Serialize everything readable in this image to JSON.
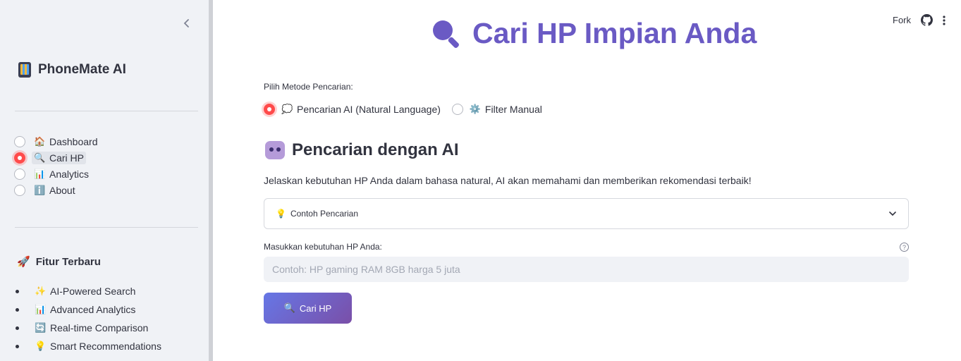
{
  "sidebar": {
    "brand_icon": "mobile-phone-icon",
    "brand": "PhoneMate AI",
    "nav": [
      {
        "icon": "🏠",
        "label": "Dashboard",
        "selected": false
      },
      {
        "icon": "🔍",
        "label": "Cari HP",
        "selected": true
      },
      {
        "icon": "📊",
        "label": "Analytics",
        "selected": false
      },
      {
        "icon": "ℹ️",
        "label": "About",
        "selected": false
      }
    ],
    "features_icon": "🚀",
    "features_title": "Fitur Terbaru",
    "features": [
      {
        "icon": "✨",
        "label": "AI-Powered Search"
      },
      {
        "icon": "📊",
        "label": "Advanced Analytics"
      },
      {
        "icon": "🔄",
        "label": "Real-time Comparison"
      },
      {
        "icon": "💡",
        "label": "Smart Recommendations"
      }
    ]
  },
  "topbar": {
    "fork_label": "Fork"
  },
  "main": {
    "title": "Cari HP Impian Anda",
    "method_label": "Pilih Metode Pencarian:",
    "methods": [
      {
        "icon": "💭",
        "label": "Pencarian AI (Natural Language)",
        "selected": true
      },
      {
        "icon": "⚙️",
        "label": "Filter Manual",
        "selected": false
      }
    ],
    "section_title": "Pencarian dengan AI",
    "description": "Jelaskan kebutuhan HP Anda dalam bahasa natural, AI akan memahami dan memberikan rekomendasi terbaik!",
    "expander_icon": "💡",
    "expander_label": "Contoh Pencarian",
    "input_label": "Masukkan kebutuhan HP Anda:",
    "input_placeholder": "Contoh: HP gaming RAM 8GB harga 5 juta",
    "input_value": "",
    "button_icon": "🔍",
    "button_label": "Cari HP"
  },
  "colors": {
    "accent": "#ff4b4b",
    "title": "#6a5ac4",
    "button_start": "#6677e6",
    "button_end": "#7a4fa8",
    "sidebar_bg": "#f0f2f6"
  }
}
